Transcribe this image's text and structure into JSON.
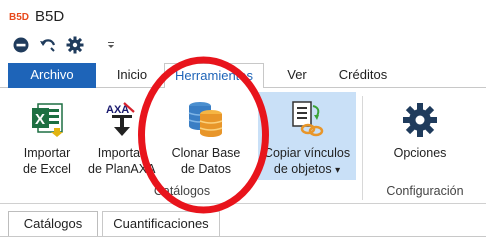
{
  "app": {
    "title": "B5D",
    "icon_text": "B5D",
    "icon": "app-logo-icon"
  },
  "quick_access": [
    {
      "name": "remove-circle-icon",
      "icon": "remove-circle-icon"
    },
    {
      "name": "undo-icon",
      "icon": "undo-icon"
    },
    {
      "name": "gear-icon",
      "icon": "gear-icon"
    },
    {
      "name": "customize-dropdown-icon",
      "icon": "chevron-down-icon"
    }
  ],
  "tabs": [
    {
      "label": "Archivo",
      "style": "file"
    },
    {
      "label": "Inicio",
      "style": "normal"
    },
    {
      "label": "Herramientas",
      "style": "active"
    },
    {
      "label": "Ver",
      "style": "normal"
    },
    {
      "label": "Créditos",
      "style": "normal"
    }
  ],
  "ribbon": {
    "groups": [
      {
        "label": "Catálogos",
        "buttons": [
          {
            "line1": "Importar",
            "line2": "de Excel",
            "icon": "excel-import-icon"
          },
          {
            "line1": "Importar",
            "line2": "de PlanAXA",
            "icon": "axa-import-icon"
          },
          {
            "line1": "Clonar Base",
            "line2": "de Datos",
            "icon": "database-clone-icon"
          },
          {
            "line1": "Copiar vínculos",
            "line2": "de objetos",
            "line2_suffix": "▾",
            "icon": "copy-links-icon"
          }
        ]
      },
      {
        "label": "Configuración",
        "buttons": [
          {
            "line1": "Opciones",
            "line2": "",
            "icon": "gear-icon"
          }
        ]
      }
    ]
  },
  "document_tabs": [
    {
      "label": "Catálogos",
      "active": true
    },
    {
      "label": "Cuantificaciones",
      "active": false
    }
  ],
  "colors": {
    "accent": "#1e64b8",
    "highlight": "#c9e0f7",
    "annotation": "#e8141c"
  }
}
